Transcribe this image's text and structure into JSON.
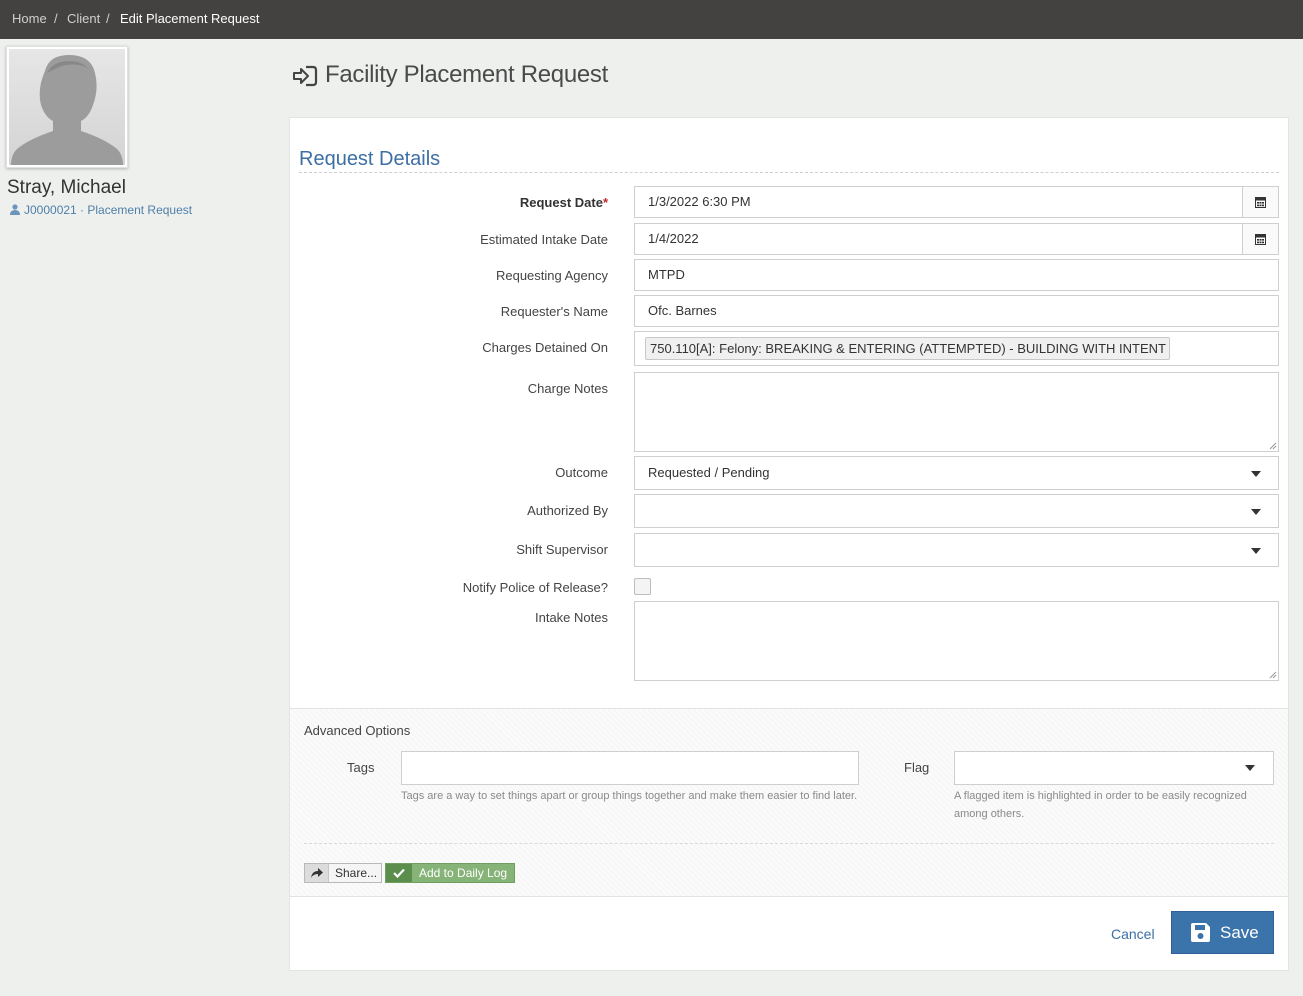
{
  "breadcrumb": [
    "Home",
    "Client",
    "Edit Placement Request"
  ],
  "breadcrumb_sep": "/",
  "client": {
    "name": "Stray, Michael",
    "subline": "J0000021 · Placement Request"
  },
  "page": {
    "title": "Facility Placement Request"
  },
  "section": {
    "title": "Request Details"
  },
  "form": {
    "request_date": {
      "label": "Request Date",
      "value": "1/3/2022 6:30 PM"
    },
    "estimated_intake_date": {
      "label": "Estimated Intake Date",
      "value": "1/4/2022"
    },
    "requesting_agency": {
      "label": "Requesting Agency",
      "value": "MTPD"
    },
    "requesters_name": {
      "label": "Requester's Name",
      "value": "Ofc. Barnes"
    },
    "charges_detained_on": {
      "label": "Charges Detained On",
      "tags": [
        "750.110[A]: Felony: BREAKING & ENTERING (ATTEMPTED) - BUILDING WITH INTENT"
      ]
    },
    "charge_notes": {
      "label": "Charge Notes",
      "value": ""
    },
    "outcome": {
      "label": "Outcome",
      "value": "Requested / Pending"
    },
    "authorized_by": {
      "label": "Authorized By",
      "value": ""
    },
    "shift_supervisor": {
      "label": "Shift Supervisor",
      "value": ""
    },
    "notify_police": {
      "label": "Notify Police of Release?",
      "checked": false
    },
    "intake_notes": {
      "label": "Intake Notes",
      "value": ""
    }
  },
  "advanced": {
    "title": "Advanced Options",
    "tags_label": "Tags",
    "tags_help": "Tags are a way to set things apart or group things together and make them easier to find later.",
    "flag_label": "Flag",
    "flag_help": "A flagged item is highlighted in order to be easily recognized among others."
  },
  "actions": {
    "share_label": "Share...",
    "daily_log_label": "Add to Daily Log",
    "cancel_label": "Cancel",
    "save_label": "Save"
  },
  "colors": {
    "topbar": "#434240",
    "accent": "#3d6fa3",
    "save_button": "#3b73ab",
    "daily_log_button": "#86b377",
    "required": "#c62828"
  },
  "icons": {
    "title": "sign-in-icon",
    "date": "calendar-icon",
    "share": "share-icon",
    "daily_log": "check-icon",
    "save": "floppy-disk-icon",
    "client": "user-icon"
  }
}
